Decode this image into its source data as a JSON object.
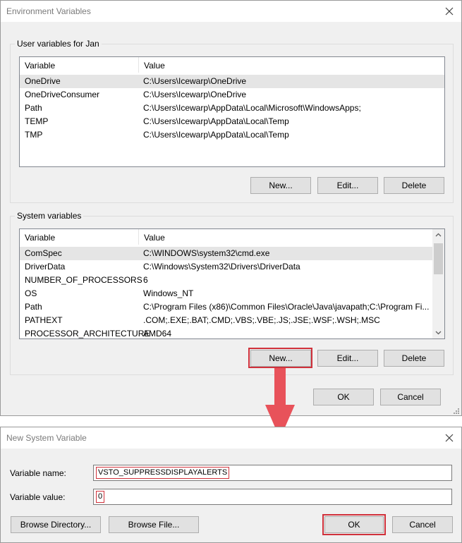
{
  "env_window": {
    "title": "Environment Variables",
    "user_group": {
      "label": "User variables for Jan",
      "columns": [
        "Variable",
        "Value"
      ],
      "rows": [
        {
          "variable": "OneDrive",
          "value": "C:\\Users\\Icewarp\\OneDrive"
        },
        {
          "variable": "OneDriveConsumer",
          "value": "C:\\Users\\Icewarp\\OneDrive"
        },
        {
          "variable": "Path",
          "value": "C:\\Users\\Icewarp\\AppData\\Local\\Microsoft\\WindowsApps;"
        },
        {
          "variable": "TEMP",
          "value": "C:\\Users\\Icewarp\\AppData\\Local\\Temp"
        },
        {
          "variable": "TMP",
          "value": "C:\\Users\\Icewarp\\AppData\\Local\\Temp"
        }
      ],
      "buttons": {
        "new": "New...",
        "edit": "Edit...",
        "delete": "Delete"
      }
    },
    "system_group": {
      "label": "System variables",
      "columns": [
        "Variable",
        "Value"
      ],
      "rows": [
        {
          "variable": "ComSpec",
          "value": "C:\\WINDOWS\\system32\\cmd.exe"
        },
        {
          "variable": "DriverData",
          "value": "C:\\Windows\\System32\\Drivers\\DriverData"
        },
        {
          "variable": "NUMBER_OF_PROCESSORS",
          "value": "6"
        },
        {
          "variable": "OS",
          "value": "Windows_NT"
        },
        {
          "variable": "Path",
          "value": "C:\\Program Files (x86)\\Common Files\\Oracle\\Java\\javapath;C:\\Program Fi..."
        },
        {
          "variable": "PATHEXT",
          "value": ".COM;.EXE;.BAT;.CMD;.VBS;.VBE;.JS;.JSE;.WSF;.WSH;.MSC"
        },
        {
          "variable": "PROCESSOR_ARCHITECTURE",
          "value": "AMD64"
        }
      ],
      "buttons": {
        "new": "New...",
        "edit": "Edit...",
        "delete": "Delete"
      }
    },
    "ok": "OK",
    "cancel": "Cancel"
  },
  "new_var_window": {
    "title": "New System Variable",
    "name_label": "Variable name:",
    "name_value": "VSTO_SUPPRESSDISPLAYALERTS",
    "value_label": "Variable value:",
    "value_value": "0",
    "browse_directory": "Browse Directory...",
    "browse_file": "Browse File...",
    "ok": "OK",
    "cancel": "Cancel"
  },
  "colors": {
    "highlight": "#d0313b",
    "arrow": "#e8525a"
  }
}
